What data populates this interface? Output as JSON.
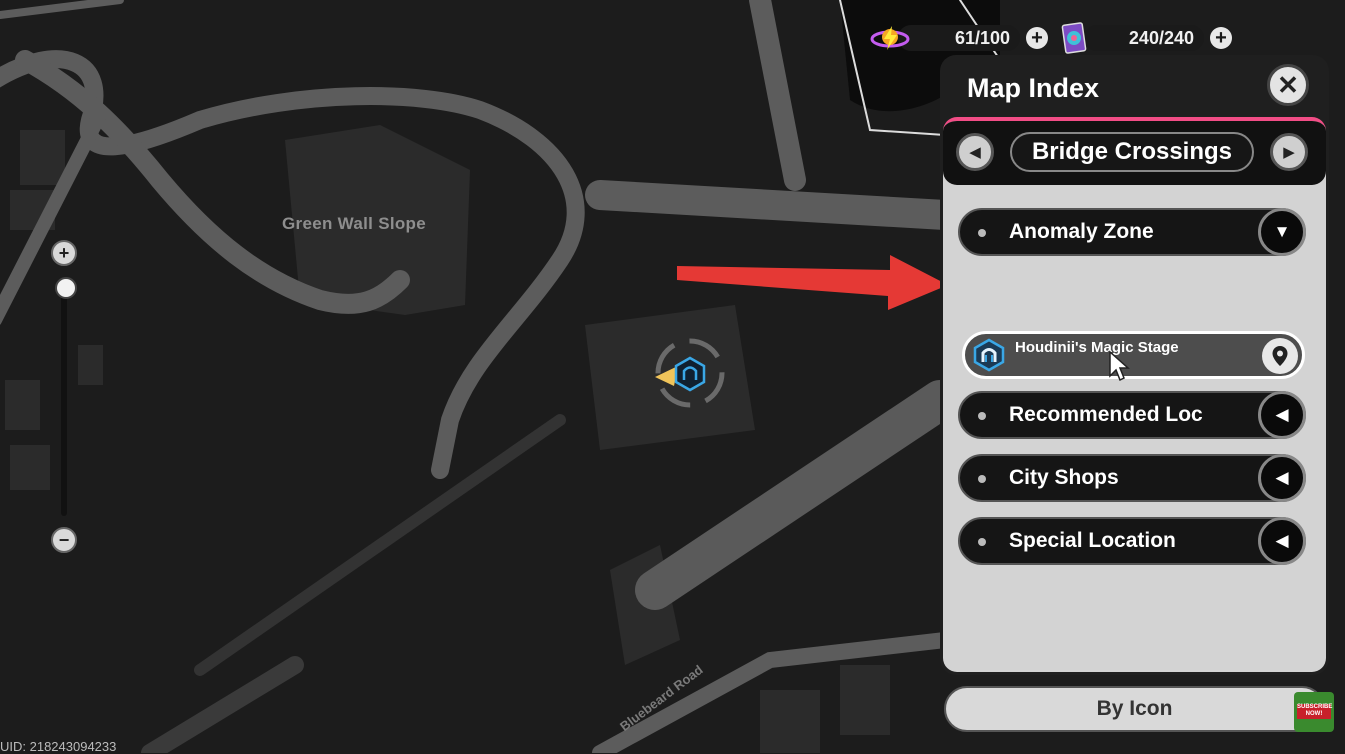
{
  "map": {
    "region_label": "Green Wall Slope",
    "road_label": "Bluebeard Road",
    "uid": "UID: 218243094233"
  },
  "currencies": [
    {
      "name": "energy",
      "value": "61/100",
      "icon": "energy-orb-icon"
    },
    {
      "name": "cards",
      "value": "240/240",
      "icon": "card-deck-icon"
    }
  ],
  "zoom": {
    "in_icon": "plus-icon",
    "out_icon": "minus-icon",
    "level": 0.96
  },
  "panel": {
    "title": "Map Index",
    "close_icon": "close-icon",
    "category": "Bridge Crossings",
    "groups": [
      {
        "label": "Anomaly Zone",
        "state": "expanded"
      },
      {
        "label": "Recommended Loc",
        "state": "collapsed"
      },
      {
        "label": "City Shops",
        "state": "collapsed"
      },
      {
        "label": "Special Location",
        "state": "collapsed"
      }
    ],
    "selected_item": {
      "label": "Houdinii's Magic Stage",
      "icon": "magic-stage-icon",
      "action_icon": "map-pin-icon"
    },
    "by_icon_label": "By Icon"
  },
  "accent_colors": {
    "panel_tab": "#f24d86",
    "annotation_arrow": "#e53935",
    "location_icon": "#3aa7e6"
  },
  "overlay": {
    "subscribe_text": "SUBSCRIBE NOW!"
  }
}
